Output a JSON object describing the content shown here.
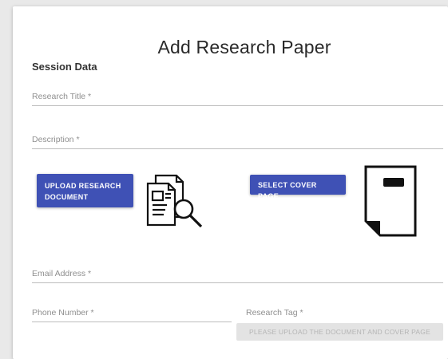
{
  "form": {
    "title": "Add Research Paper",
    "section_label": "Session Data",
    "research_title_placeholder": "Research Title *",
    "description_placeholder": "Description *",
    "upload_document_label": "UPLOAD RESEARCH DOCUMENT",
    "select_cover_label": "SELECT COVER PAGE",
    "email_placeholder": "Email Address *",
    "phone_placeholder": "Phone Number *",
    "research_tag_label": "Research Tag *",
    "disabled_button_label": "PLEASE UPLOAD THE DOCUMENT AND COVER PAGE"
  },
  "icons": {
    "document": "document-search-icon",
    "cover": "cover-page-icon"
  },
  "colors": {
    "primary": "#3f51b5",
    "text": "#2a2a2a",
    "placeholder": "#8f8f8f",
    "disabled_bg": "#e3e3e3"
  }
}
